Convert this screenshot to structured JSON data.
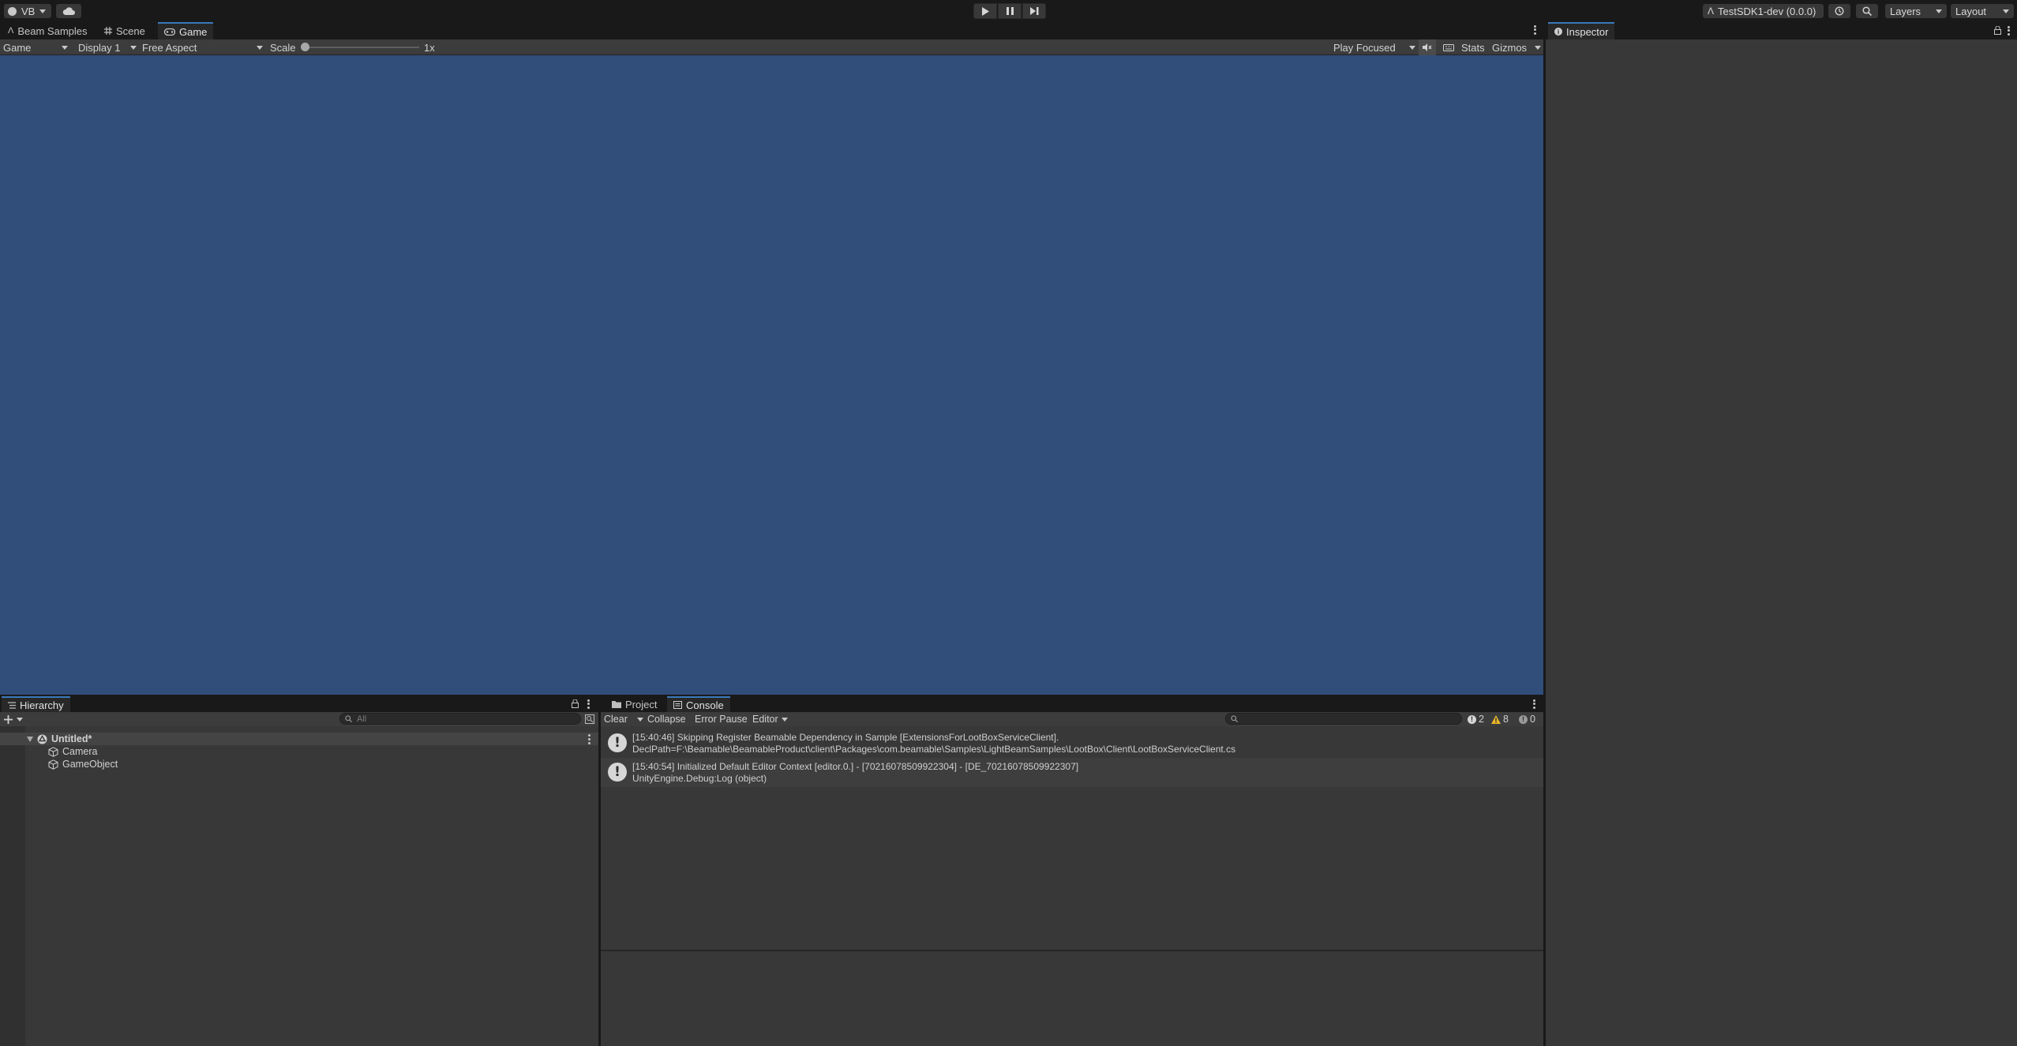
{
  "toolbar": {
    "account_label": "VB",
    "project_label": "TestSDK1-dev (0.0.0)",
    "layers_label": "Layers",
    "layout_label": "Layout"
  },
  "game_panel": {
    "tabs": [
      {
        "label": "Beam Samples",
        "icon": "beam-icon"
      },
      {
        "label": "Scene",
        "icon": "grid-icon"
      },
      {
        "label": "Game",
        "icon": "gamepad-icon"
      }
    ],
    "mode_label": "Game",
    "display_label": "Display 1",
    "aspect_label": "Free Aspect",
    "scale_label": "Scale",
    "scale_value": "1x",
    "play_focused_label": "Play Focused",
    "stats_label": "Stats",
    "gizmos_label": "Gizmos",
    "background_color": "#314d79"
  },
  "inspector": {
    "tab_label": "Inspector"
  },
  "hierarchy": {
    "tab_label": "Hierarchy",
    "search_placeholder": "All",
    "scene_name": "Untitled*",
    "objects": [
      "Camera",
      "GameObject"
    ]
  },
  "console": {
    "tabs": [
      {
        "label": "Project",
        "icon": "folder-icon"
      },
      {
        "label": "Console",
        "icon": "console-icon"
      }
    ],
    "clear_label": "Clear",
    "collapse_label": "Collapse",
    "error_pause_label": "Error Pause",
    "editor_label": "Editor",
    "counts": {
      "info": "2",
      "warning": "8",
      "error": "0"
    },
    "logs": [
      {
        "line1": "[15:40:46] Skipping Register Beamable Dependency in Sample [ExtensionsForLootBoxServiceClient].",
        "line2": "DeclPath=F:\\Beamable\\BeamableProduct\\client\\Packages\\com.beamable\\Samples\\LightBeamSamples\\LootBox\\Client\\LootBoxServiceClient.cs"
      },
      {
        "line1": "[15:40:54] Initialized Default Editor Context [editor.0.] - [70216078509922304] - [DE_70216078509922307]",
        "line2": "UnityEngine.Debug:Log (object)"
      }
    ]
  }
}
